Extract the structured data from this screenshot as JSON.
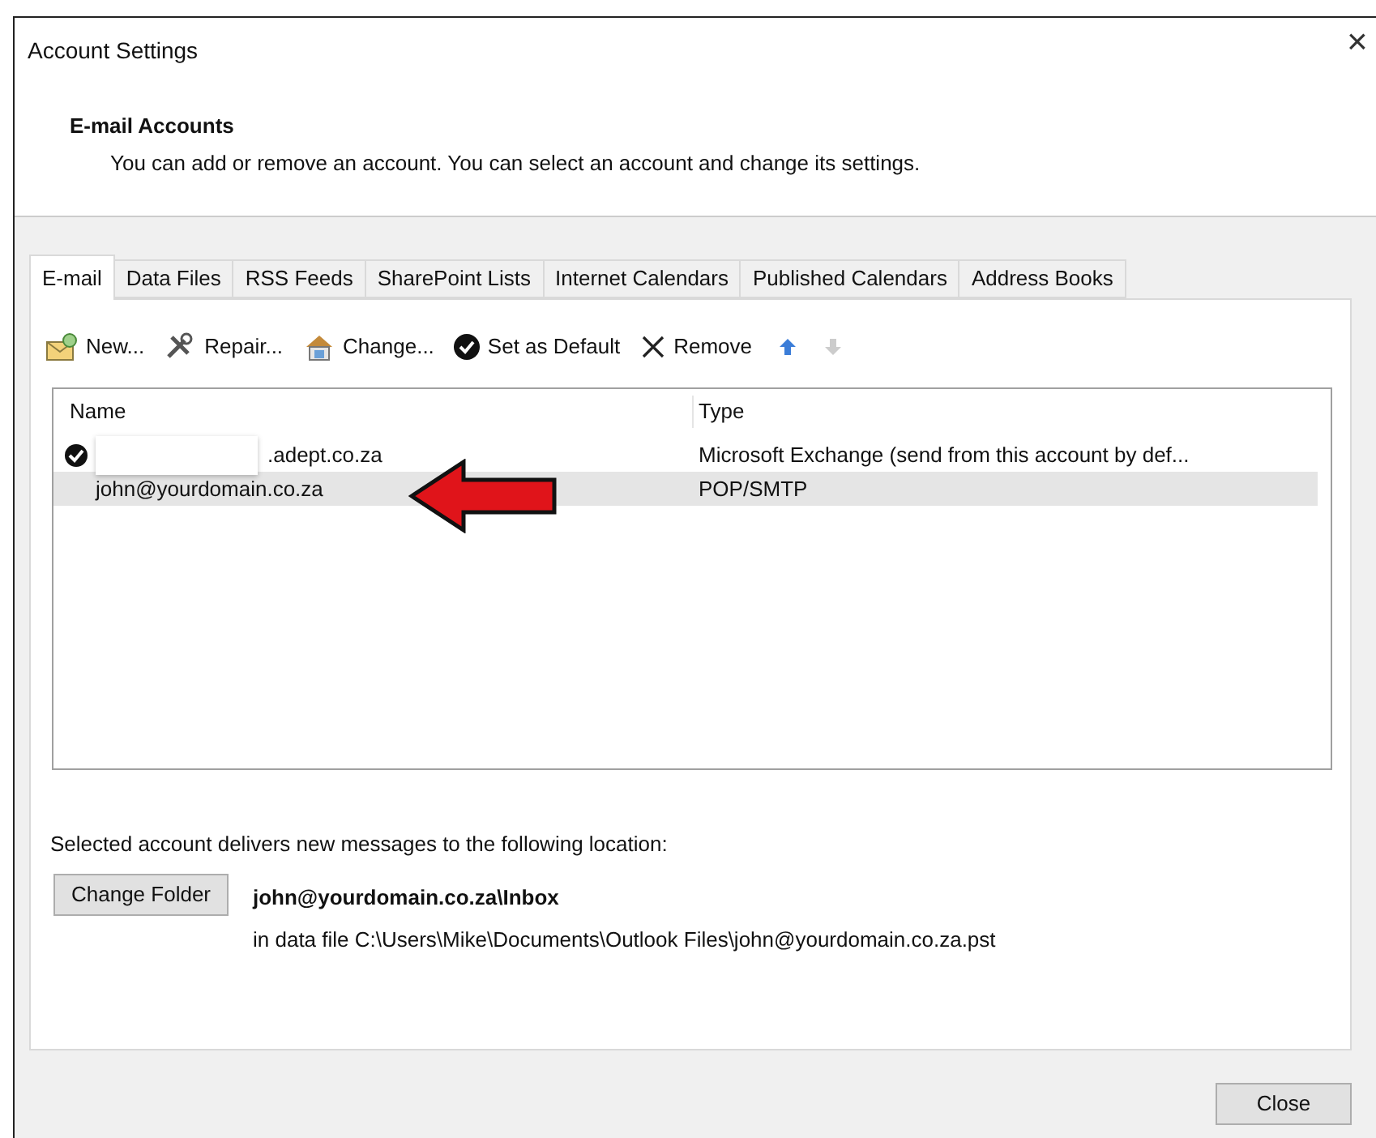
{
  "window": {
    "title": "Account Settings",
    "close": "×"
  },
  "header": {
    "title": "E-mail Accounts",
    "description": "You can add or remove an account. You can select an account and change its settings."
  },
  "tabs": [
    {
      "label": "E-mail",
      "selected": true
    },
    {
      "label": "Data Files",
      "selected": false
    },
    {
      "label": "RSS Feeds",
      "selected": false
    },
    {
      "label": "SharePoint Lists",
      "selected": false
    },
    {
      "label": "Internet Calendars",
      "selected": false
    },
    {
      "label": "Published Calendars",
      "selected": false
    },
    {
      "label": "Address Books",
      "selected": false
    }
  ],
  "toolbar": [
    {
      "kind": "new",
      "label": "New...",
      "disabled": false
    },
    {
      "kind": "repair",
      "label": "Repair...",
      "disabled": false
    },
    {
      "kind": "change",
      "label": "Change...",
      "disabled": false
    },
    {
      "kind": "default",
      "label": "Set as Default",
      "disabled": false
    },
    {
      "kind": "remove",
      "label": "Remove",
      "disabled": false
    },
    {
      "kind": "up",
      "disabled": false
    },
    {
      "kind": "down",
      "disabled": true
    }
  ],
  "accounts": {
    "columns": [
      "Name",
      "Type"
    ],
    "rows": [
      {
        "name": ".adept.co.za",
        "type": "Microsoft Exchange (send from this account by def...",
        "default": true,
        "redacted": true,
        "selected": false
      },
      {
        "name": "john@yourdomain.co.za",
        "type": "POP/SMTP",
        "default": false,
        "redacted": false,
        "selected": true
      }
    ]
  },
  "annotation": {
    "kind": "arrow"
  },
  "delivery": {
    "label": "Selected account delivers new messages to the following location:",
    "button": "Change Folder",
    "folder": "john@yourdomain.co.za\\Inbox",
    "data_file": "in data file C:\\Users\\Mike\\Documents\\Outlook Files\\john@yourdomain.co.za.pst"
  },
  "footer": {
    "button": "Close"
  }
}
